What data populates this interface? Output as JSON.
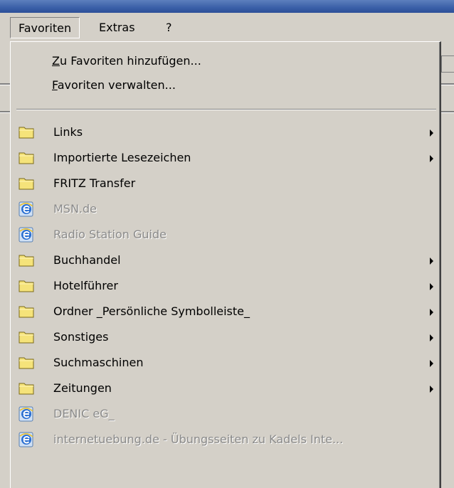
{
  "menubar": {
    "items": [
      {
        "label": "Favoriten",
        "active": true
      },
      {
        "label": "Extras",
        "active": false
      },
      {
        "label": "?",
        "active": false
      }
    ]
  },
  "menu": {
    "top_items": [
      {
        "label_acc": "Z",
        "label_rest": "u Favoriten hinzufügen..."
      },
      {
        "label_acc": "F",
        "label_rest": "avoriten verwalten..."
      }
    ],
    "items": [
      {
        "label": "Links",
        "icon": "folder-icon",
        "submenu": true,
        "disabled": false
      },
      {
        "label": "Importierte Lesezeichen",
        "icon": "folder-icon",
        "submenu": true,
        "disabled": false
      },
      {
        "label": "FRITZ Transfer",
        "icon": "folder-icon",
        "submenu": false,
        "disabled": false
      },
      {
        "label": "MSN.de",
        "icon": "ie-link-icon",
        "submenu": false,
        "disabled": true
      },
      {
        "label": "Radio Station Guide",
        "icon": "ie-link-icon",
        "submenu": false,
        "disabled": true
      },
      {
        "label": "Buchhandel",
        "icon": "folder-icon",
        "submenu": true,
        "disabled": false
      },
      {
        "label": "Hotelführer",
        "icon": "folder-icon",
        "submenu": true,
        "disabled": false
      },
      {
        "label": "Ordner _Persönliche Symbolleiste_",
        "icon": "folder-icon",
        "submenu": true,
        "disabled": false
      },
      {
        "label": "Sonstiges",
        "icon": "folder-icon",
        "submenu": true,
        "disabled": false
      },
      {
        "label": "Suchmaschinen",
        "icon": "folder-icon",
        "submenu": true,
        "disabled": false
      },
      {
        "label": "Zeitungen",
        "icon": "folder-icon",
        "submenu": true,
        "disabled": false
      },
      {
        "label": "DENIC eG_",
        "icon": "ie-link-icon",
        "submenu": false,
        "disabled": true
      },
      {
        "label": "internetuebung.de - Übungsseiten zu Kadels Inte...",
        "icon": "ie-link-icon",
        "submenu": false,
        "disabled": true
      }
    ]
  },
  "colors": {
    "face": "#d4d0c8",
    "disabled_text": "#8a8a8a",
    "folder": "#f5e37a",
    "ie_blue": "#2a6fd1"
  }
}
